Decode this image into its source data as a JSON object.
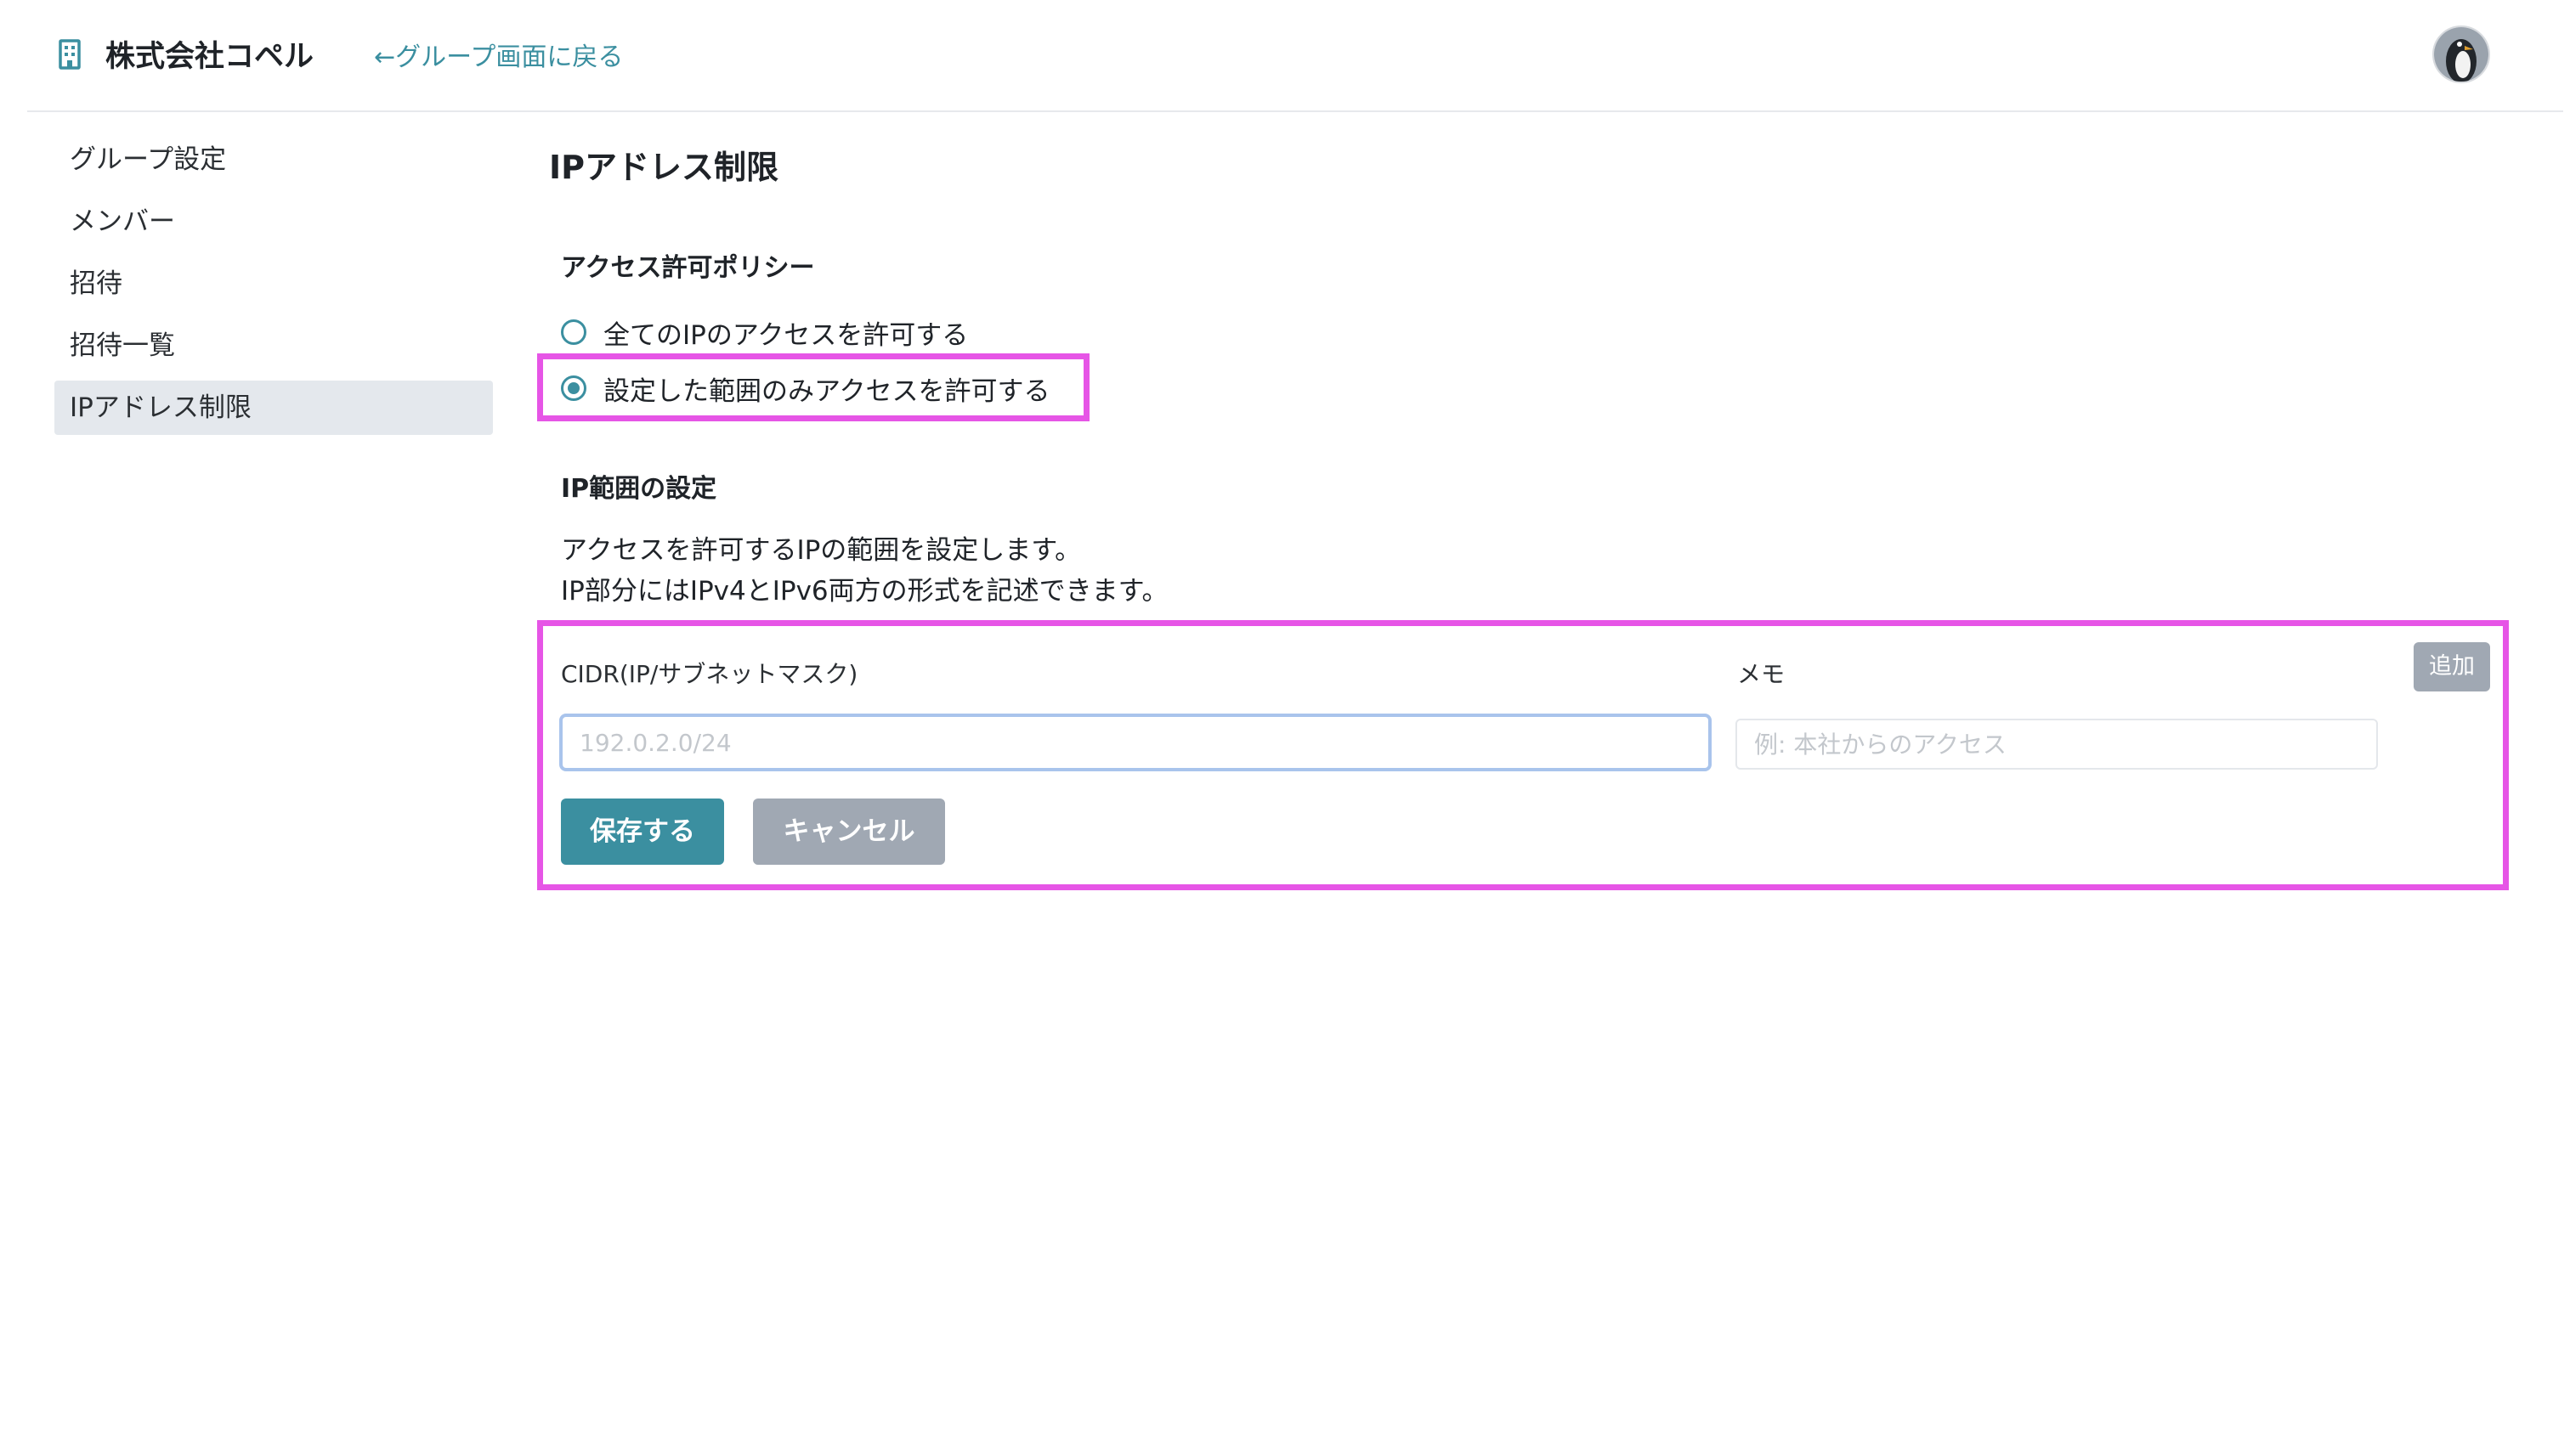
{
  "header": {
    "org_icon": "building-icon",
    "org_name": "株式会社コペル",
    "back_link": "←グループ画面に戻る",
    "avatar": "penguin-avatar"
  },
  "sidebar": {
    "items": [
      {
        "label": "グループ設定",
        "active": false
      },
      {
        "label": "メンバー",
        "active": false
      },
      {
        "label": "招待",
        "active": false
      },
      {
        "label": "招待一覧",
        "active": false
      },
      {
        "label": "IPアドレス制限",
        "active": true
      }
    ]
  },
  "main": {
    "title": "IPアドレス制限",
    "policy": {
      "heading": "アクセス許可ポリシー",
      "options": [
        {
          "label": "全てのIPのアクセスを許可する",
          "checked": false
        },
        {
          "label": "設定した範囲のみアクセスを許可する",
          "checked": true
        }
      ]
    },
    "ip_range": {
      "heading": "IP範囲の設定",
      "description": [
        "アクセスを許可するIPの範囲を設定します。",
        "IP部分にはIPv4とIPv6両方の形式を記述できます。"
      ],
      "cidr_label": "CIDR(IP/サブネットマスク)",
      "cidr_placeholder": "192.0.2.0/24",
      "cidr_value": "",
      "memo_label": "メモ",
      "memo_placeholder": "例: 本社からのアクセス",
      "memo_value": "",
      "add_label": "追加",
      "save_label": "保存する",
      "cancel_label": "キャンセル"
    }
  },
  "colors": {
    "accent": "#3b8fa0",
    "highlight": "#e655e6",
    "muted_button": "#a0a8b3",
    "active_nav_bg": "#e4e8ed"
  }
}
